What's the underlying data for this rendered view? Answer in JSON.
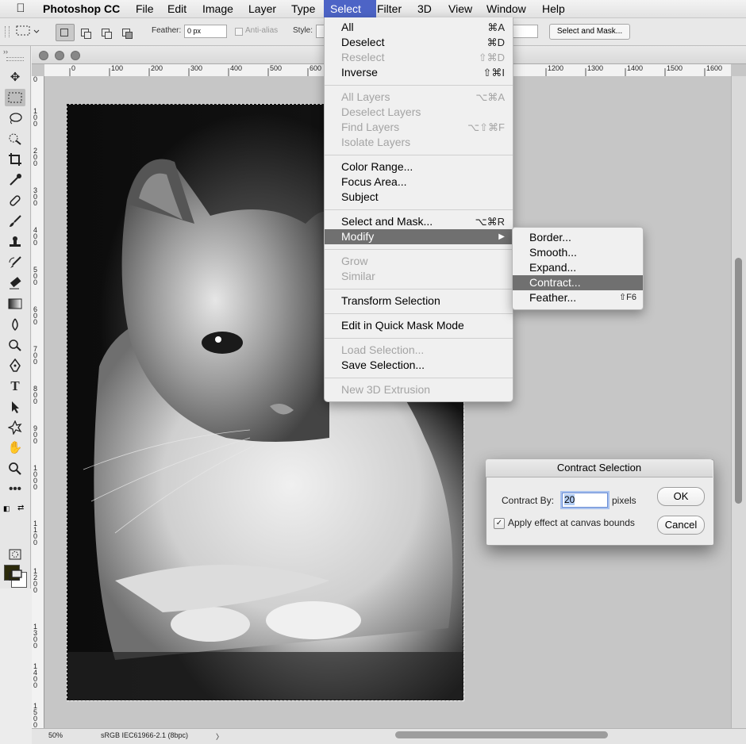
{
  "app": {
    "name": "Photoshop CC",
    "menus": [
      "File",
      "Edit",
      "Image",
      "Layer",
      "Type",
      "Select",
      "Filter",
      "3D",
      "View",
      "Window",
      "Help"
    ],
    "active_menu": "Select"
  },
  "options_bar": {
    "feather_label": "Feather:",
    "feather_value": "0 px",
    "antialias_label": "Anti-alias",
    "style_label": "Style:",
    "select_mask_button": "Select and Mask..."
  },
  "rulers": {
    "horizontal": [
      "0",
      "100",
      "200",
      "300",
      "400",
      "500",
      "600",
      "1200",
      "1300",
      "1400",
      "1500",
      "1600"
    ],
    "vertical": [
      "0",
      "1 0 0",
      "2 0 0",
      "3 0 0",
      "4 0 0",
      "5 0 0",
      "6 0 0",
      "7 0 0",
      "8 0 0",
      "9 0 0",
      "1 0 0 0",
      "1 1 0 0",
      "1 2 0 0",
      "1 3 0 0",
      "1 4 0 0",
      "1 5 0 0"
    ]
  },
  "select_menu": {
    "items": [
      {
        "label": "All",
        "shortcut": "⌘A",
        "disabled": false
      },
      {
        "label": "Deselect",
        "shortcut": "⌘D",
        "disabled": false
      },
      {
        "label": "Reselect",
        "shortcut": "⇧⌘D",
        "disabled": true
      },
      {
        "label": "Inverse",
        "shortcut": "⇧⌘I",
        "disabled": false
      },
      {
        "label": "All Layers",
        "shortcut": "⌥⌘A",
        "disabled": true
      },
      {
        "label": "Deselect Layers",
        "shortcut": "",
        "disabled": true
      },
      {
        "label": "Find Layers",
        "shortcut": "⌥⇧⌘F",
        "disabled": true
      },
      {
        "label": "Isolate Layers",
        "shortcut": "",
        "disabled": true
      },
      {
        "label": "Color Range...",
        "shortcut": "",
        "disabled": false
      },
      {
        "label": "Focus Area...",
        "shortcut": "",
        "disabled": false
      },
      {
        "label": "Subject",
        "shortcut": "",
        "disabled": false
      },
      {
        "label": "Select and Mask...",
        "shortcut": "⌥⌘R",
        "disabled": false
      },
      {
        "label": "Modify",
        "shortcut": "▶",
        "disabled": false
      },
      {
        "label": "Grow",
        "shortcut": "",
        "disabled": true
      },
      {
        "label": "Similar",
        "shortcut": "",
        "disabled": true
      },
      {
        "label": "Transform Selection",
        "shortcut": "",
        "disabled": false
      },
      {
        "label": "Edit in Quick Mask Mode",
        "shortcut": "",
        "disabled": false
      },
      {
        "label": "Load Selection...",
        "shortcut": "",
        "disabled": true
      },
      {
        "label": "Save Selection...",
        "shortcut": "",
        "disabled": false
      },
      {
        "label": "New 3D Extrusion",
        "shortcut": "",
        "disabled": true
      }
    ]
  },
  "modify_submenu": {
    "items": [
      {
        "label": "Border...",
        "shortcut": ""
      },
      {
        "label": "Smooth...",
        "shortcut": ""
      },
      {
        "label": "Expand...",
        "shortcut": ""
      },
      {
        "label": "Contract...",
        "shortcut": ""
      },
      {
        "label": "Feather...",
        "shortcut": "⇧F6"
      }
    ],
    "highlighted": "Contract..."
  },
  "dialog": {
    "title": "Contract Selection",
    "contract_label": "Contract By:",
    "contract_value": "20",
    "unit": "pixels",
    "checkbox_label": "Apply effect at canvas bounds",
    "checkbox_checked": true,
    "ok_label": "OK",
    "cancel_label": "Cancel"
  },
  "status": {
    "zoom": "50%",
    "profile": "sRGB IEC61966-2.1 (8bpc)",
    "arrow": "〉"
  },
  "colors": {
    "foreground": "#2b2a0a",
    "background": "#ffffff",
    "menu_highlight": "#707070"
  },
  "icons": [
    "apple-icon",
    "move-icon",
    "marquee-icon",
    "lasso-icon",
    "quick-select-icon",
    "crop-icon",
    "eyedropper-icon",
    "healing-icon",
    "brush-icon",
    "stamp-icon",
    "history-brush-icon",
    "eraser-icon",
    "gradient-icon",
    "blur-icon",
    "dodge-icon",
    "pen-icon",
    "type-icon",
    "path-select-icon",
    "shape-icon",
    "hand-icon",
    "zoom-icon",
    "more-tools-icon",
    "quick-mask-icon",
    "screen-mode-icon"
  ]
}
